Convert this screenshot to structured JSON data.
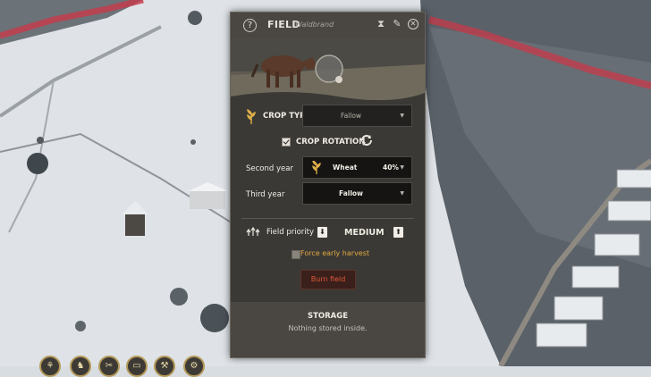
{
  "panel": {
    "help_icon": "?",
    "title": "FIELD",
    "subtitle": "Waldbrand",
    "icons": [
      "hourglass-icon",
      "pin-icon",
      "close-icon"
    ]
  },
  "crop": {
    "type_label": "CROP TYPE",
    "type_value": "Fallow",
    "rotation_label": "CROP ROTATION",
    "rotation_checked": true,
    "second_year_label": "Second year",
    "second_year_crop": "Wheat",
    "second_year_percent": "40%",
    "third_year_label": "Third year",
    "third_year_crop": "Fallow"
  },
  "priority": {
    "label": "Field priority",
    "value": "MEDIUM",
    "force_harvest_label": "Force early harvest",
    "force_harvest_checked": false,
    "burn_label": "Burn field"
  },
  "storage": {
    "title": "STORAGE",
    "text": "Nothing stored inside."
  },
  "bottom_bar": {
    "icons": [
      "wheat-icon",
      "horse-icon",
      "tools-icon",
      "chest-icon",
      "hammer-icon",
      "gear-icon"
    ]
  },
  "colors": {
    "panel_bg": "#3b3936",
    "accent_gold": "#d9a53a",
    "burn_red": "#e25a3a",
    "warning_orange": "#e0a840"
  }
}
